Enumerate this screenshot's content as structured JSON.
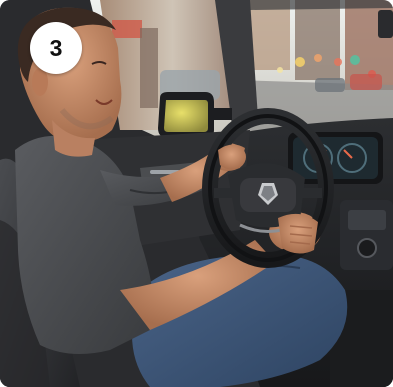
{
  "photo": {
    "subject": "man-driving-car-icon",
    "step_badge": "3",
    "colors": {
      "windshield_sky": "#dfe6ea",
      "street_blur": "#b9a79a",
      "shirt": "#4b4d50",
      "jeans": "#3c5474",
      "dashboard": "#1f2124",
      "seat": "#3a3c40",
      "steering_wheel": "#202225",
      "skin": "#c98e6a"
    }
  }
}
